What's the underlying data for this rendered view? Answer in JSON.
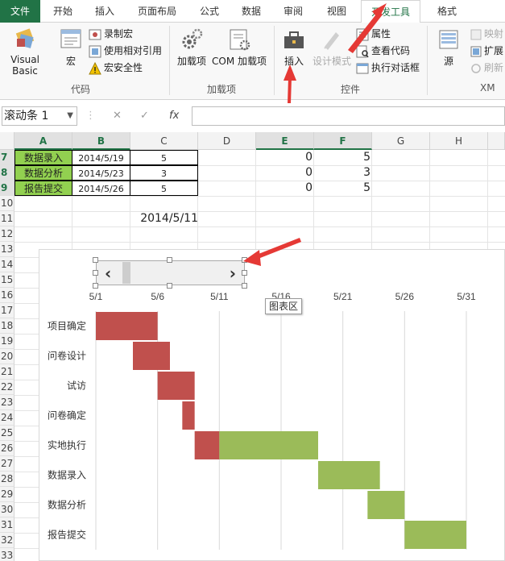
{
  "tabs": [
    "文件",
    "开始",
    "插入",
    "页面布局",
    "公式",
    "数据",
    "审阅",
    "视图",
    "开发工具",
    "格式"
  ],
  "ribbon": {
    "code": {
      "visual_basic": "Visual Basic",
      "macro": "宏",
      "record_macro": "录制宏",
      "relative_ref": "使用相对引用",
      "macro_security": "宏安全性",
      "label": "代码"
    },
    "addins": {
      "addin": "加载项",
      "com_addin": "COM 加载项",
      "label": "加载项"
    },
    "controls": {
      "insert": "插入",
      "design_mode": "设计模式",
      "properties": "属性",
      "view_code": "查看代码",
      "run_dialog": "执行对话框",
      "label": "控件"
    },
    "xml": {
      "source": "源",
      "map_props": "映射",
      "expansion": "扩展",
      "refresh": "刷新",
      "label": "XM"
    }
  },
  "formula_bar": {
    "name_box": "滚动条 1",
    "cancel": "✕",
    "enter": "✓",
    "fx": "fx",
    "formula": ""
  },
  "columns": [
    "A",
    "B",
    "C",
    "D",
    "E",
    "F",
    "G",
    "H"
  ],
  "rows": [
    "7",
    "8",
    "9",
    "10",
    "11",
    "12",
    "13",
    "14",
    "15",
    "16",
    "17",
    "18",
    "19",
    "20",
    "21",
    "22",
    "23",
    "24",
    "25",
    "26",
    "27",
    "28",
    "29",
    "30",
    "31",
    "32",
    "33"
  ],
  "table": [
    {
      "a": "数据录入",
      "b": "2014/5/19",
      "c": "5",
      "e": "0",
      "f": "5"
    },
    {
      "a": "数据分析",
      "b": "2014/5/23",
      "c": "3",
      "e": "0",
      "f": "3"
    },
    {
      "a": "报告提交",
      "b": "2014/5/26",
      "c": "5",
      "e": "0",
      "f": "5"
    }
  ],
  "c11": "2014/5/11",
  "tooltip": "图表区",
  "scrollbar": {
    "left_arrow": "‹",
    "right_arrow": "›"
  },
  "chart_data": {
    "type": "bar",
    "x_ticks": [
      "5/1",
      "5/6",
      "5/11",
      "5/16",
      "5/21",
      "5/26",
      "5/31"
    ],
    "xlim": [
      1,
      31
    ],
    "categories": [
      "项目确定",
      "问卷设计",
      "试访",
      "问卷确定",
      "实地执行",
      "数据录入",
      "数据分析",
      "报告提交"
    ],
    "series": [
      {
        "color": "#c0504d",
        "values": [
          [
            1,
            6
          ],
          [
            4,
            7
          ],
          [
            6,
            9
          ],
          [
            8,
            9
          ],
          [
            9,
            11
          ],
          null,
          null,
          null
        ]
      },
      {
        "color": "#9bbb59",
        "values": [
          null,
          null,
          null,
          null,
          [
            11,
            19
          ],
          [
            19,
            24
          ],
          [
            23,
            26
          ],
          [
            26,
            31
          ]
        ]
      }
    ]
  }
}
